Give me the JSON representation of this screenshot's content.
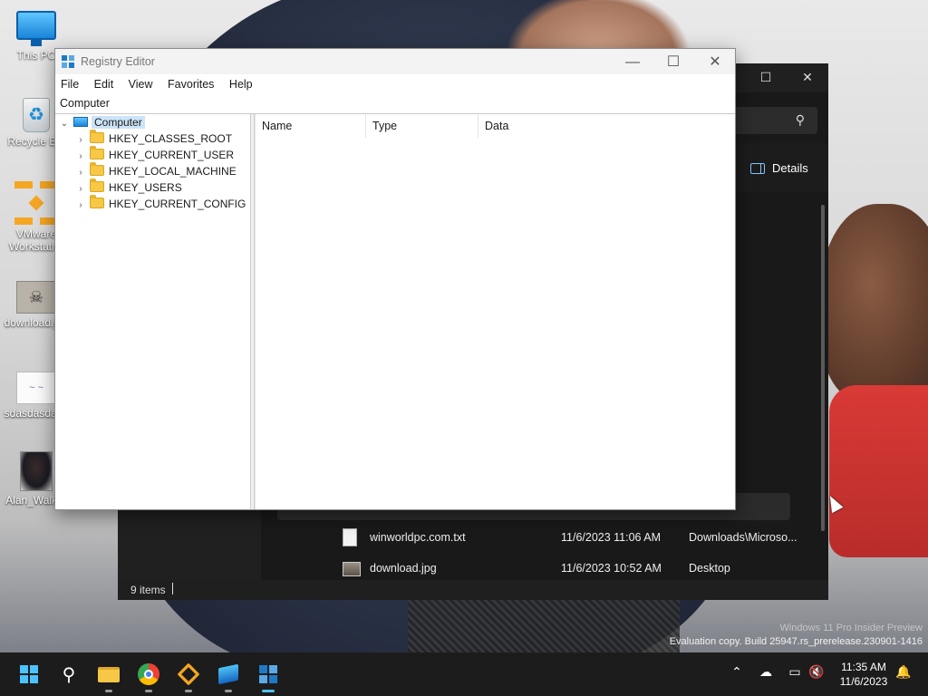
{
  "desktop": {
    "icons": [
      {
        "label": "This PC",
        "icon": "monitor-icon"
      },
      {
        "label": "Recycle Bin",
        "icon": "recycle-bin-icon"
      },
      {
        "label": "VMware Workstation",
        "icon": "vmware-icon"
      },
      {
        "label": "download.jpg",
        "icon": "image-file-icon"
      },
      {
        "label": "sdasdasdasd",
        "icon": "document-icon"
      },
      {
        "label": "Alan_Walker",
        "icon": "photo-file-icon"
      }
    ],
    "watermark": {
      "line1": "Windows 11 Pro Insider Preview",
      "line2": "Evaluation copy. Build 25947.rs_prerelease.230901-1416"
    }
  },
  "explorer": {
    "details_label": "Details",
    "rows": [
      {
        "name": "winworldpc.com.txt",
        "date": "11/6/2023 11:06 AM",
        "location": "Downloads\\Microso...",
        "icon": "text-file-icon"
      },
      {
        "name": "download.jpg",
        "date": "11/6/2023 10:52 AM",
        "location": "Desktop",
        "icon": "image-file-icon"
      }
    ],
    "status": {
      "items": "9 items"
    }
  },
  "regedit": {
    "title": "Registry Editor",
    "menu": [
      "File",
      "Edit",
      "View",
      "Favorites",
      "Help"
    ],
    "address": "Computer",
    "tree": {
      "root": "Computer",
      "children": [
        "HKEY_CLASSES_ROOT",
        "HKEY_CURRENT_USER",
        "HKEY_LOCAL_MACHINE",
        "HKEY_USERS",
        "HKEY_CURRENT_CONFIG"
      ]
    },
    "columns": [
      "Name",
      "Type",
      "Data"
    ]
  },
  "taskbar": {
    "apps": [
      "start-icon",
      "search-icon",
      "file-explorer-icon",
      "chrome-icon",
      "vmware-icon",
      "virtual-box-icon",
      "registry-editor-icon"
    ],
    "clock": {
      "time": "11:35 AM",
      "date": "11/6/2023"
    }
  },
  "colors": {
    "accent": "#4cc2ff",
    "selection": "#cce4f7",
    "folder": "#f6c846"
  }
}
